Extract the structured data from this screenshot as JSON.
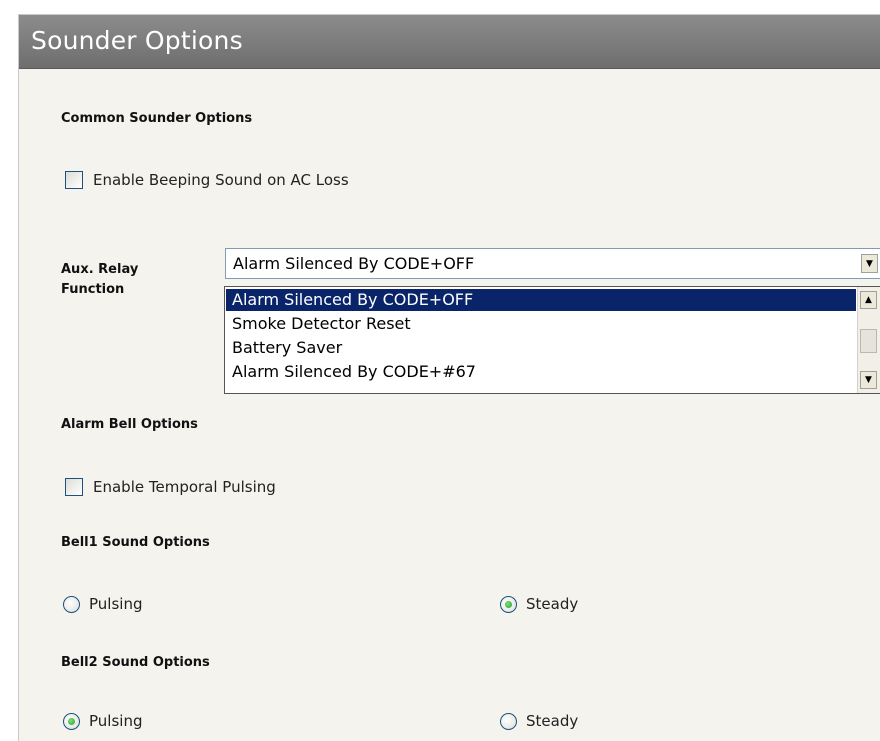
{
  "panel": {
    "title": "Sounder Options"
  },
  "common": {
    "heading": "Common Sounder Options",
    "ac_loss_label": "Enable Beeping Sound on AC Loss",
    "ac_loss_checked": false
  },
  "aux_relay": {
    "label_line1": "Aux. Relay",
    "label_line2": "Function",
    "selected_value": "Alarm Silenced By CODE+OFF",
    "options": [
      "Alarm Silenced By CODE+OFF",
      "Smoke Detector Reset",
      "Battery Saver",
      "Alarm Silenced By CODE+#67"
    ],
    "highlighted_index": 0
  },
  "alarm_bell": {
    "heading": "Alarm Bell Options",
    "temporal_label": "Enable Temporal Pulsing",
    "temporal_checked": false
  },
  "bell1": {
    "heading": "Bell1 Sound Options",
    "pulsing_label": "Pulsing",
    "steady_label": "Steady",
    "selected": "Steady"
  },
  "bell2": {
    "heading": "Bell2 Sound Options",
    "pulsing_label": "Pulsing",
    "steady_label": "Steady",
    "selected": "Pulsing"
  }
}
